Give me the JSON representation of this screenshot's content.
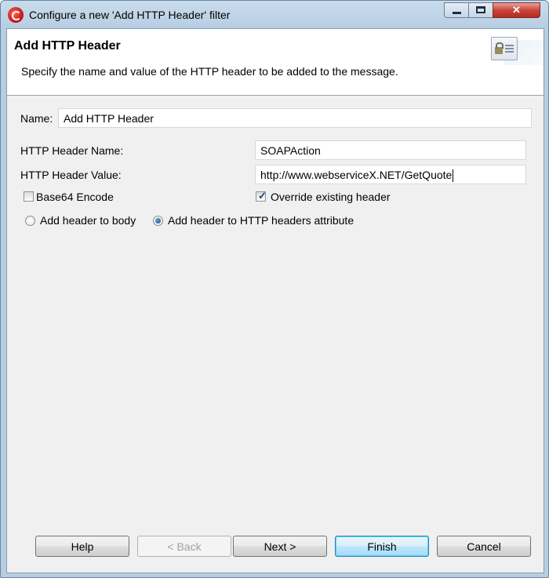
{
  "window": {
    "title": "Configure a new 'Add HTTP Header' filter",
    "controls": {
      "minimize": "minimize-icon",
      "maximize": "maximize-icon",
      "close": "close-icon"
    }
  },
  "header": {
    "title": "Add HTTP Header",
    "description": "Specify the name and value of the HTTP header to be added to the message."
  },
  "form": {
    "name_label": "Name:",
    "name_value": "Add HTTP Header",
    "header_name_label": "HTTP Header Name:",
    "header_name_value": "SOAPAction",
    "header_value_label": "HTTP Header Value:",
    "header_value_value": "http://www.webserviceX.NET/GetQuote",
    "base64_label": "Base64 Encode",
    "base64_checked": false,
    "override_label": "Override existing header",
    "override_checked": true,
    "radio_body_label": "Add header to body",
    "radio_attr_label": "Add header to HTTP headers attribute",
    "selected_target": "http_headers_attribute"
  },
  "buttons": {
    "help": "Help",
    "back": "< Back",
    "next": "Next >",
    "finish": "Finish",
    "cancel": "Cancel"
  },
  "colors": {
    "titlebar": "#b7cde2",
    "close_button": "#c9453a",
    "default_button_border": "#3c7fb1"
  }
}
